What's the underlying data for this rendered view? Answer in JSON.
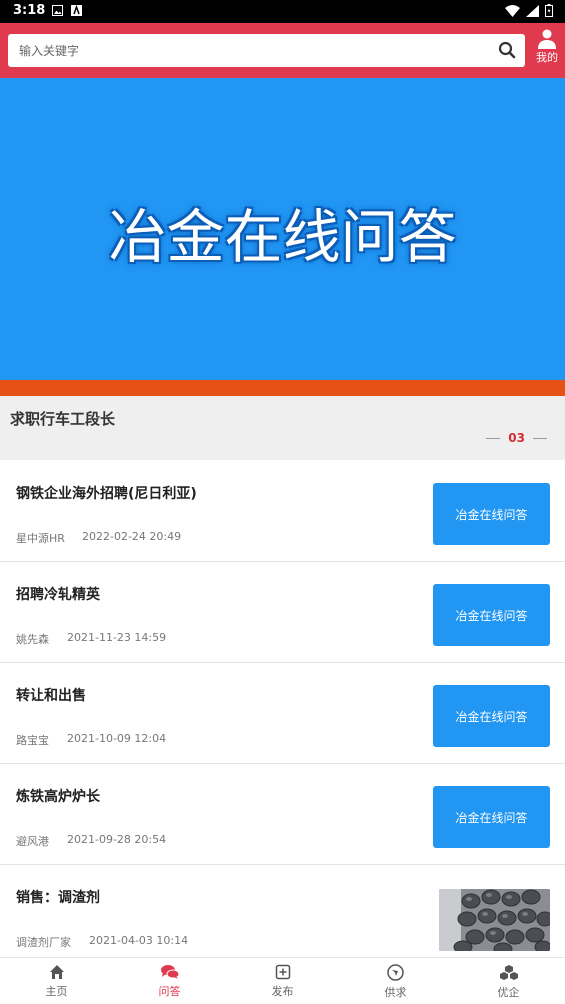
{
  "status_bar": {
    "time": "3:18"
  },
  "header": {
    "search_placeholder": "输入关键字",
    "mine_label": "我的"
  },
  "banner": {
    "title": "冶金在线问答"
  },
  "notice": {
    "text": "求职行车工段长",
    "page": "03"
  },
  "list": [
    {
      "title": "钢铁企业海外招聘(尼日利亚)",
      "author": "星中源HR",
      "date": "2022-02-24 20:49",
      "thumb_text": "冶金在线问答"
    },
    {
      "title": "招聘冷轧精英",
      "author": "姚先森",
      "date": "2021-11-23 14:59",
      "thumb_text": "冶金在线问答"
    },
    {
      "title": "转让和出售",
      "author": "路宝宝",
      "date": "2021-10-09 12:04",
      "thumb_text": "冶金在线问答"
    },
    {
      "title": "炼铁高炉炉长",
      "author": "避风港",
      "date": "2021-09-28 20:54",
      "thumb_text": "冶金在线问答"
    },
    {
      "title": "销售：调渣剂",
      "author": "调渣剂厂家",
      "date": "2021-04-03 10:14",
      "thumb_text": ""
    }
  ],
  "tabs": [
    {
      "label": "主页",
      "icon": "home-icon"
    },
    {
      "label": "问答",
      "icon": "chat-icon",
      "active": true
    },
    {
      "label": "发布",
      "icon": "plus-square-icon"
    },
    {
      "label": "供求",
      "icon": "compass-icon"
    },
    {
      "label": "优企",
      "icon": "cubes-icon"
    }
  ],
  "colors": {
    "header": "#e03a4e",
    "banner": "#2196f3",
    "orange_bar": "#e65116",
    "active_tab": "#e03a4e"
  }
}
